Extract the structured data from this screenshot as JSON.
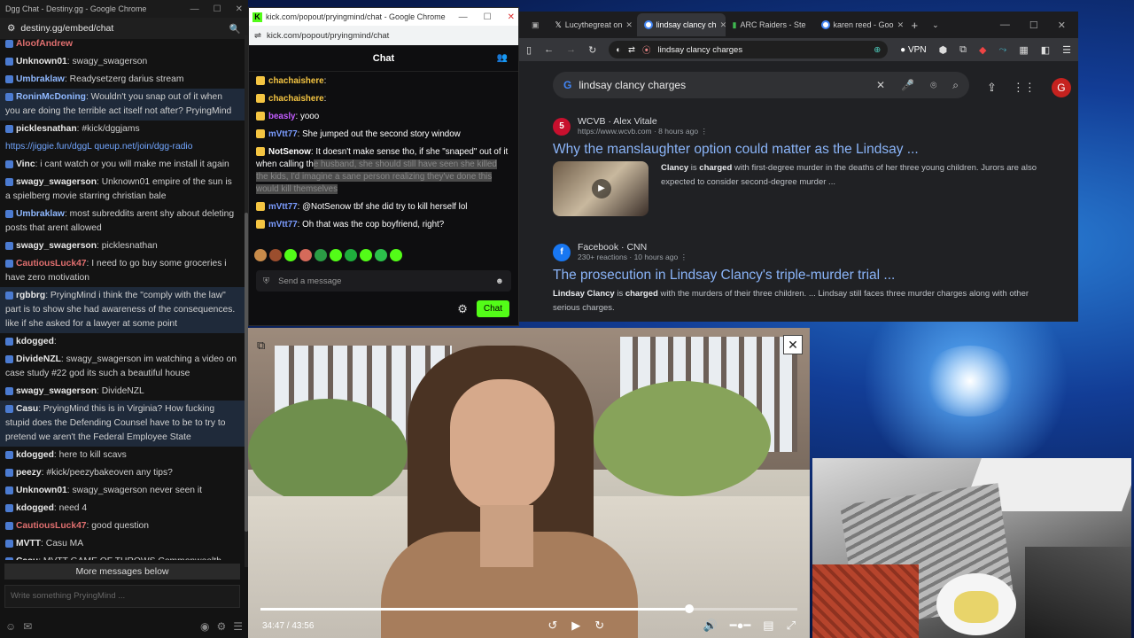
{
  "dgg": {
    "title": "Dgg Chat - Destiny.gg - Google Chrome",
    "url": "destiny.gg/embed/chat",
    "messages": [
      {
        "user": "AloofAndrew",
        "text": "",
        "style": "red"
      },
      {
        "user": "Unknown01",
        "text": ": swagy_swagerson",
        "style": ""
      },
      {
        "user": "Umbraklaw",
        "text": ": Readysetzerg darius stream",
        "style": "blue"
      },
      {
        "user": "RoninMcDoning",
        "text": ": Wouldn't you snap out of it when you are doing the terrible act itself not after? PryingMind",
        "style": "blue",
        "hl": true
      },
      {
        "user": "picklesnathan",
        "text": ": #kick/dggjams",
        "style": ""
      },
      {
        "user": "",
        "text": "https://jiggie.fun/dggL  queup.net/join/dgg-radio",
        "style": "link"
      },
      {
        "user": "Vinc",
        "text": ": i cant watch or you will make me install it again",
        "style": ""
      },
      {
        "user": "swagy_swagerson",
        "text": ": Unknown01 empire of the sun is a spielberg movie starring christian bale",
        "style": ""
      },
      {
        "user": "Umbraklaw",
        "text": ": most subreddits arent shy about deleting posts that arent allowed",
        "style": "blue"
      },
      {
        "user": "swagy_swagerson",
        "text": ": picklesnathan",
        "style": ""
      },
      {
        "user": "CautiousLuck47",
        "text": ": I need to go buy some groceries i have zero motivation",
        "style": "red"
      },
      {
        "user": "rgbbrg",
        "text": ": PryingMind i think the \"comply with the law\" part is to show she had awareness of the consequences. like if she asked for a lawyer at some point",
        "style": "",
        "hl": true
      },
      {
        "user": "kdogged",
        "text": ":",
        "style": ""
      },
      {
        "user": "DivideNZL",
        "text": ": swagy_swagerson im watching a video on case study #22 god its such a beautiful house",
        "style": ""
      },
      {
        "user": "swagy_swagerson",
        "text": ": DivideNZL",
        "style": ""
      },
      {
        "user": "Casu",
        "text": ": PryingMind this is in Virginia? How fucking stupid does the Defending Counsel have to be to try to pretend we aren't the Federal Employee State",
        "style": "",
        "hl": true
      },
      {
        "user": "kdogged",
        "text": ": here to kill scavs",
        "style": ""
      },
      {
        "user": "peezy",
        "text": ": #kick/peezybakeoven any tips?",
        "style": ""
      },
      {
        "user": "Unknown01",
        "text": ": swagy_swagerson never seen it",
        "style": ""
      },
      {
        "user": "kdogged",
        "text": ": need 4",
        "style": ""
      },
      {
        "user": "CautiousLuck47",
        "text": ": good question",
        "style": "red"
      },
      {
        "user": "MVTT",
        "text": ": Casu MA",
        "style": ""
      },
      {
        "user": "Casu",
        "text": ": MVTT  GAME OF THROWS  Commonwealth states",
        "style": ""
      }
    ],
    "more_label": "More messages below",
    "input_placeholder": "Write something PryingMind ..."
  },
  "kick": {
    "title": "kick.com/popout/pryingmind/chat - Google Chrome",
    "url": "kick.com/popout/pryingmind/chat",
    "header": "Chat",
    "messages": [
      {
        "user": "chachaishere",
        "color": "#f5c542",
        "text": ":"
      },
      {
        "user": "chachaishere",
        "color": "#f5c542",
        "text": ":"
      },
      {
        "user": "beasly",
        "color": "#c25cff",
        "text": ": yooo"
      },
      {
        "user": "mVtt77",
        "color": "#7b9cff",
        "text": ": She jumped out the second story window"
      },
      {
        "user": "NotSenow",
        "color": "#ffffff",
        "text": ": It doesn't make sense tho, if she \"snaped\" out of it when calling th",
        "sel": "e husband, she should still have seen she killed the kids, I'd imagine a sane person realizing they've done this would kill themselves"
      },
      {
        "user": "mVtt77",
        "color": "#7b9cff",
        "text": ": @NotSenow tbf she did try to kill herself lol"
      },
      {
        "user": "mVtt77",
        "color": "#7b9cff",
        "text": ": Oh that was the cop boyfriend, right?"
      }
    ],
    "send_placeholder": "Send a message",
    "chat_button": "Chat"
  },
  "chrome": {
    "tabs": [
      "Lucythegreat on",
      "lindsay clancy ch",
      "ARC Raiders - Ste",
      "karen reed - Goo"
    ],
    "address": "lindsay clancy charges",
    "vpn": "VPN",
    "search_query": "lindsay clancy charges",
    "avatar_letter": "G",
    "results": [
      {
        "source": "WCVB · Alex Vitale",
        "url": "https://www.wcvb.com",
        "age": "8 hours ago",
        "title": "Why the manslaughter option could matter as the Lindsay ...",
        "snippet_b": "Clancy",
        "snippet_mid": " is ",
        "snippet_b2": "charged",
        "snippet": " with first-degree murder in the deaths of her three young children. Jurors are also expected to consider second-degree murder ..."
      },
      {
        "source": "Facebook · CNN",
        "url": "230+ reactions",
        "age": "10 hours ago",
        "title": "The prosecution in Lindsay Clancy's triple-murder trial ...",
        "snippet_b": "Lindsay Clancy",
        "snippet_mid": " is ",
        "snippet_b2": "charged",
        "snippet": " with the murders of their three children. ... Lindsay still faces three murder charges along with other serious charges."
      }
    ]
  },
  "video": {
    "time": "34:47 / 43:56",
    "progress": 0.79
  },
  "colors": {
    "kick_green": "#53fc18",
    "link_blue": "#8ab4f8",
    "dgg_highlight": "#1f2a3a"
  }
}
